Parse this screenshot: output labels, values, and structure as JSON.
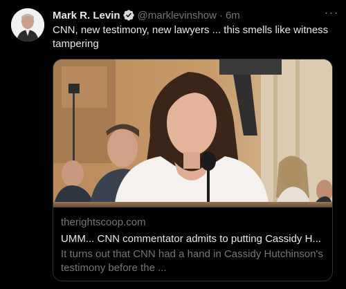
{
  "tweet": {
    "author_name": "Mark R. Levin",
    "handle": "@marklevinshow",
    "separator": "·",
    "time": "6m",
    "text": "CNN, new testimony, new lawyers ... this smells like witness tampering",
    "more_icon": "more-icon"
  },
  "card": {
    "domain": "therightscoop.com",
    "title": "UMM... CNN commentator admits to putting Cassidy H...",
    "description": "It turns out that CNN had a hand in Cassidy Hutchinson's testimony before the ..."
  },
  "colors": {
    "background": "#000000",
    "text_primary": "#e7e9ea",
    "text_secondary": "#71767b",
    "verified_badge": "#d9d9d9",
    "border": "#2f3336"
  }
}
